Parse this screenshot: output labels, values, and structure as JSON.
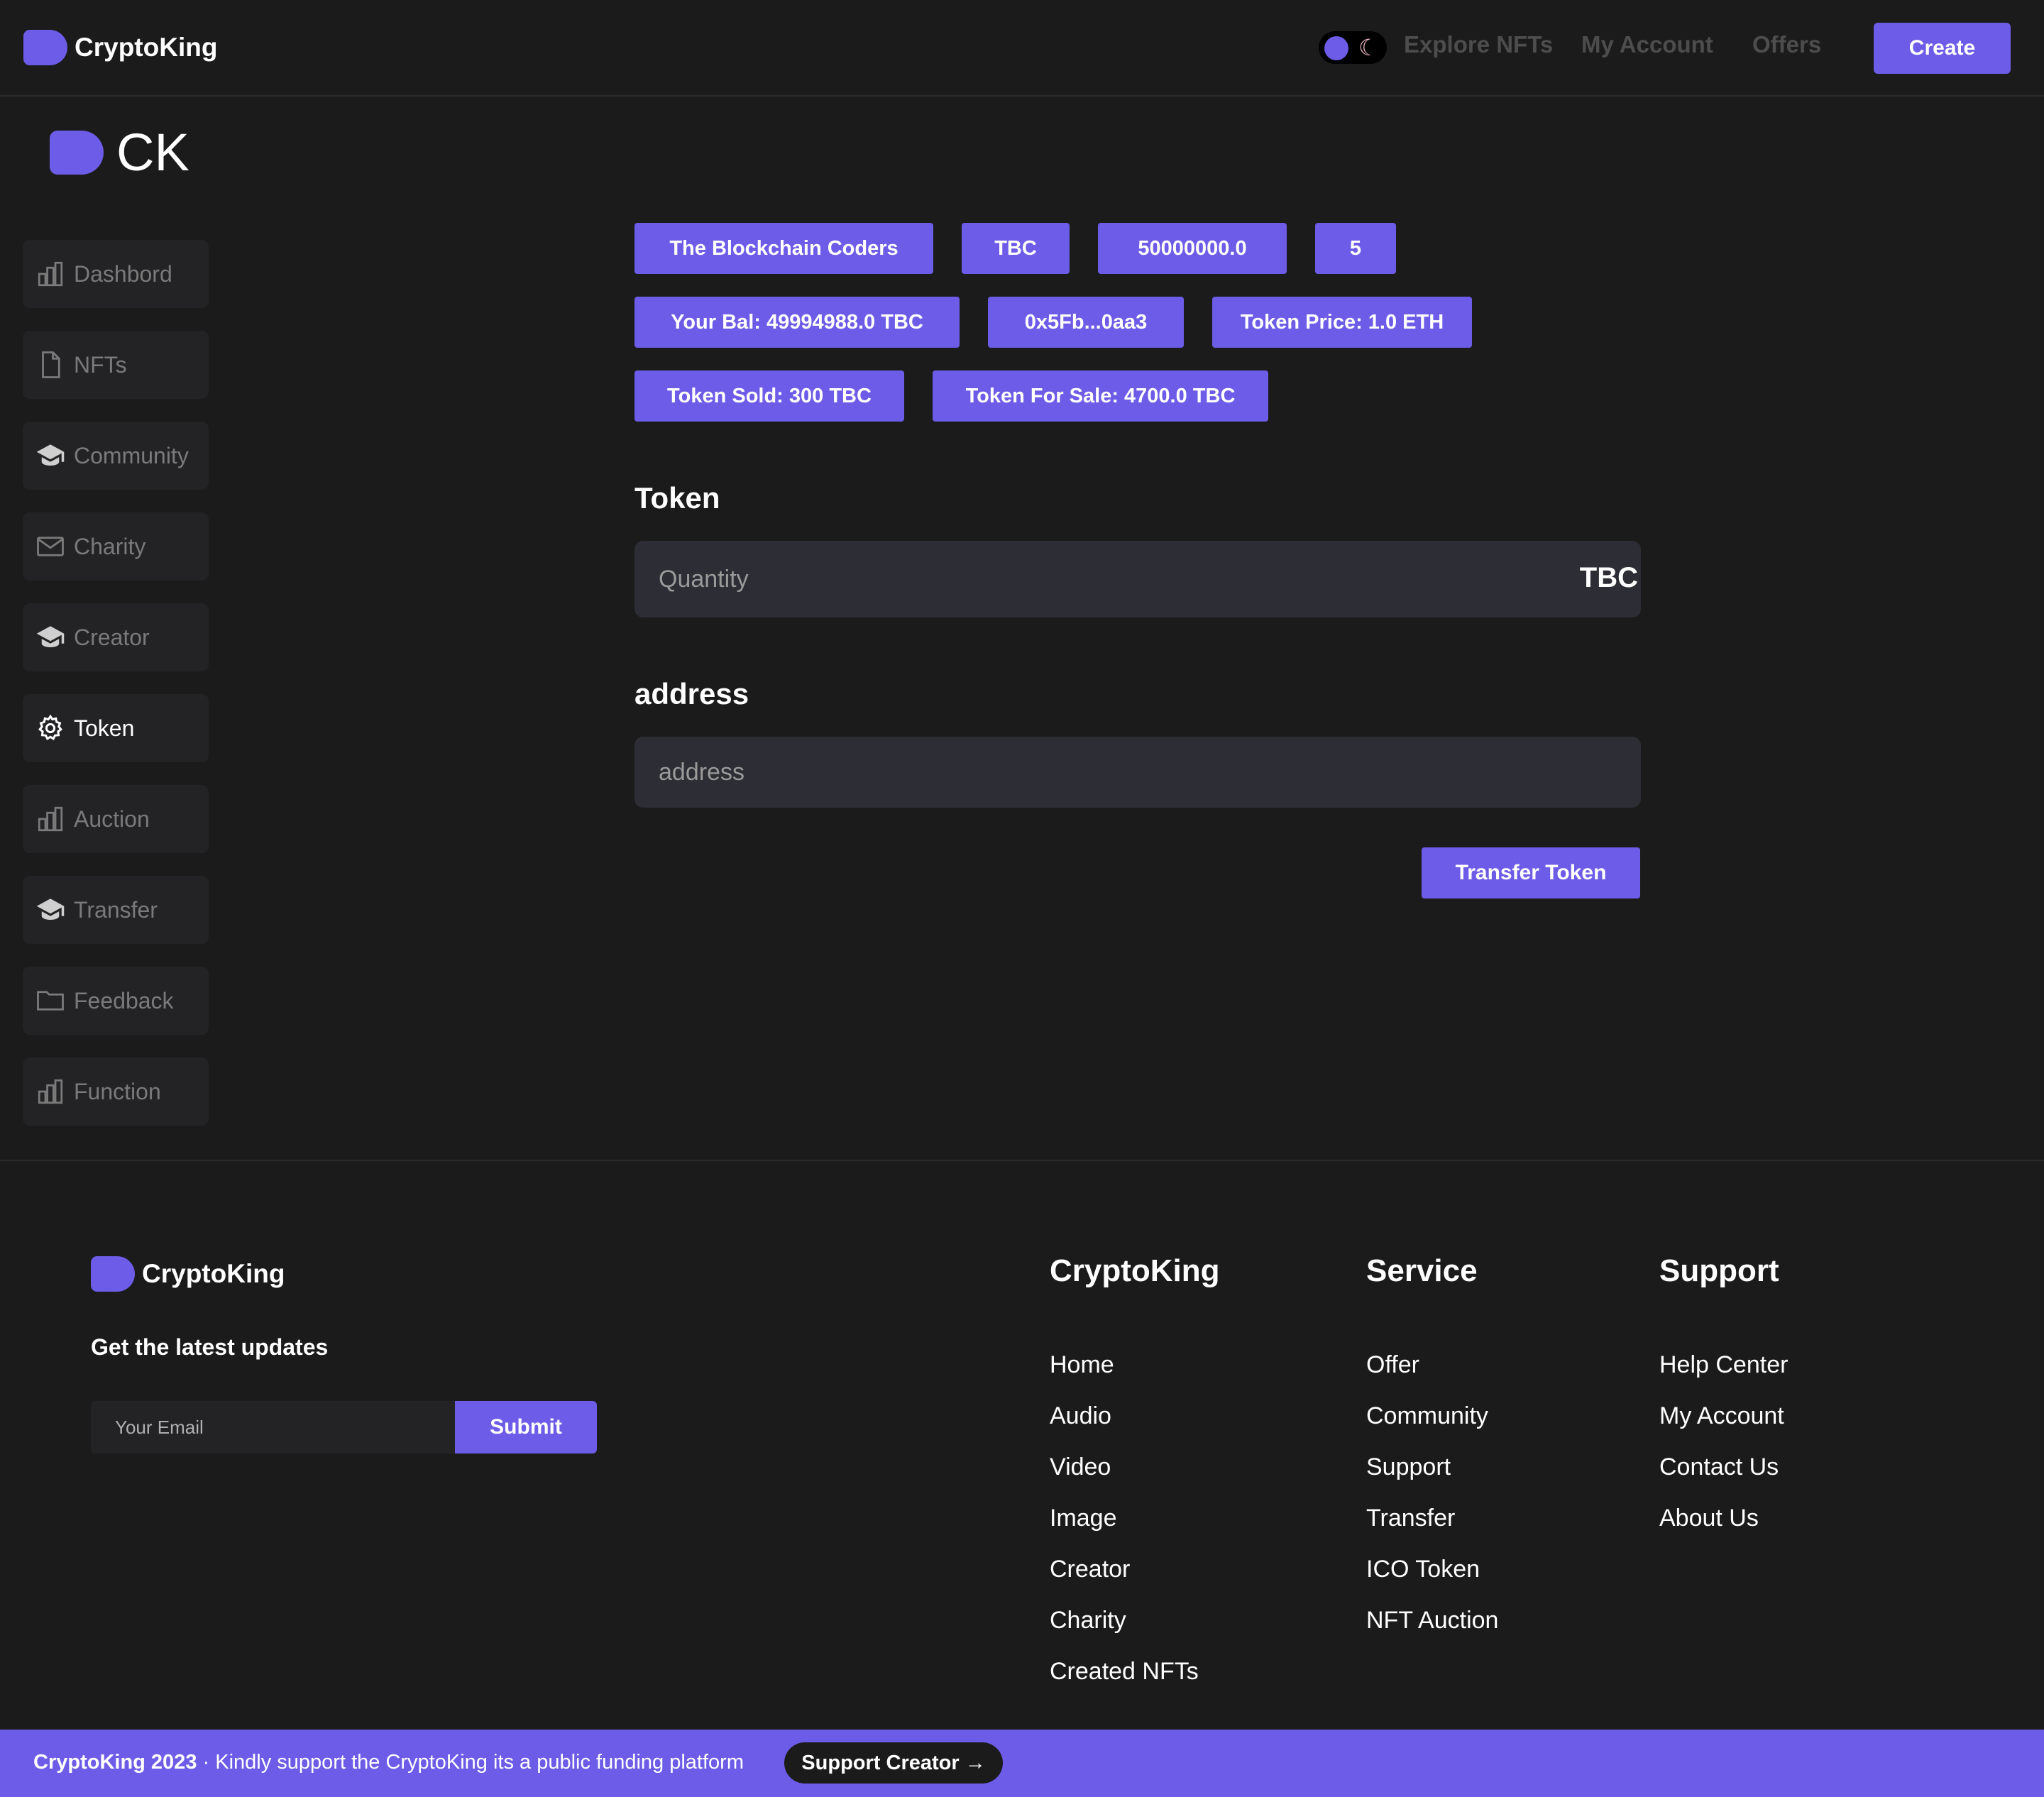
{
  "header": {
    "brand": "CryptoKing",
    "nav": [
      "Explore NFTs",
      "My Account",
      "Offers"
    ],
    "create_label": "Create"
  },
  "sidebar": {
    "logo_text": "CK",
    "items": [
      {
        "label": "Dashbord",
        "icon": "bar-chart-icon"
      },
      {
        "label": "NFTs",
        "icon": "file-icon"
      },
      {
        "label": "Community",
        "icon": "graduation-cap-icon"
      },
      {
        "label": "Charity",
        "icon": "mail-icon"
      },
      {
        "label": "Creator",
        "icon": "graduation-cap-icon"
      },
      {
        "label": "Token",
        "icon": "gear-icon",
        "active": true
      },
      {
        "label": "Auction",
        "icon": "bar-chart-icon"
      },
      {
        "label": "Transfer",
        "icon": "graduation-cap-icon"
      },
      {
        "label": "Feedback",
        "icon": "folder-icon"
      },
      {
        "label": "Function",
        "icon": "bar-chart-icon"
      }
    ]
  },
  "token_info": {
    "name": "The Blockchain Coders",
    "symbol": "TBC",
    "supply": "50000000.0",
    "holders": "5",
    "balance": "Your Bal: 49994988.0 TBC",
    "address": "0x5Fb...0aa3",
    "price": "Token Price: 1.0 ETH",
    "sold": "Token Sold: 300 TBC",
    "for_sale": "Token For Sale: 4700.0 TBC"
  },
  "form": {
    "token_title": "Token",
    "quantity_placeholder": "Quantity",
    "quantity_unit": "TBC",
    "address_title": "address",
    "address_placeholder": "address",
    "submit_label": "Transfer Token"
  },
  "footer": {
    "brand": "CryptoKing",
    "updates_label": "Get the latest updates",
    "email_placeholder": "Your Email",
    "submit_label": "Submit",
    "columns": [
      {
        "title": "CryptoKing",
        "links": [
          "Home",
          "Audio",
          "Video",
          "Image",
          "Creator",
          "Charity",
          "Created NFTs"
        ]
      },
      {
        "title": "Service",
        "links": [
          "Offer",
          "Community",
          "Support",
          "Transfer",
          "ICO Token",
          "NFT Auction"
        ]
      },
      {
        "title": "Support",
        "links": [
          "Help Center",
          "My Account",
          "Contact Us",
          "About Us"
        ]
      }
    ]
  },
  "bottom_bar": {
    "copyright": "CryptoKing 2023",
    "separator": "·",
    "message": "Kindly support the CryptoKing its a public funding platform",
    "button_label": "Support Creator",
    "button_arrow": "→"
  },
  "colors": {
    "accent": "#6c5ce7",
    "background": "#1b1b1b",
    "panel": "#232325",
    "input": "#2d2d35"
  }
}
